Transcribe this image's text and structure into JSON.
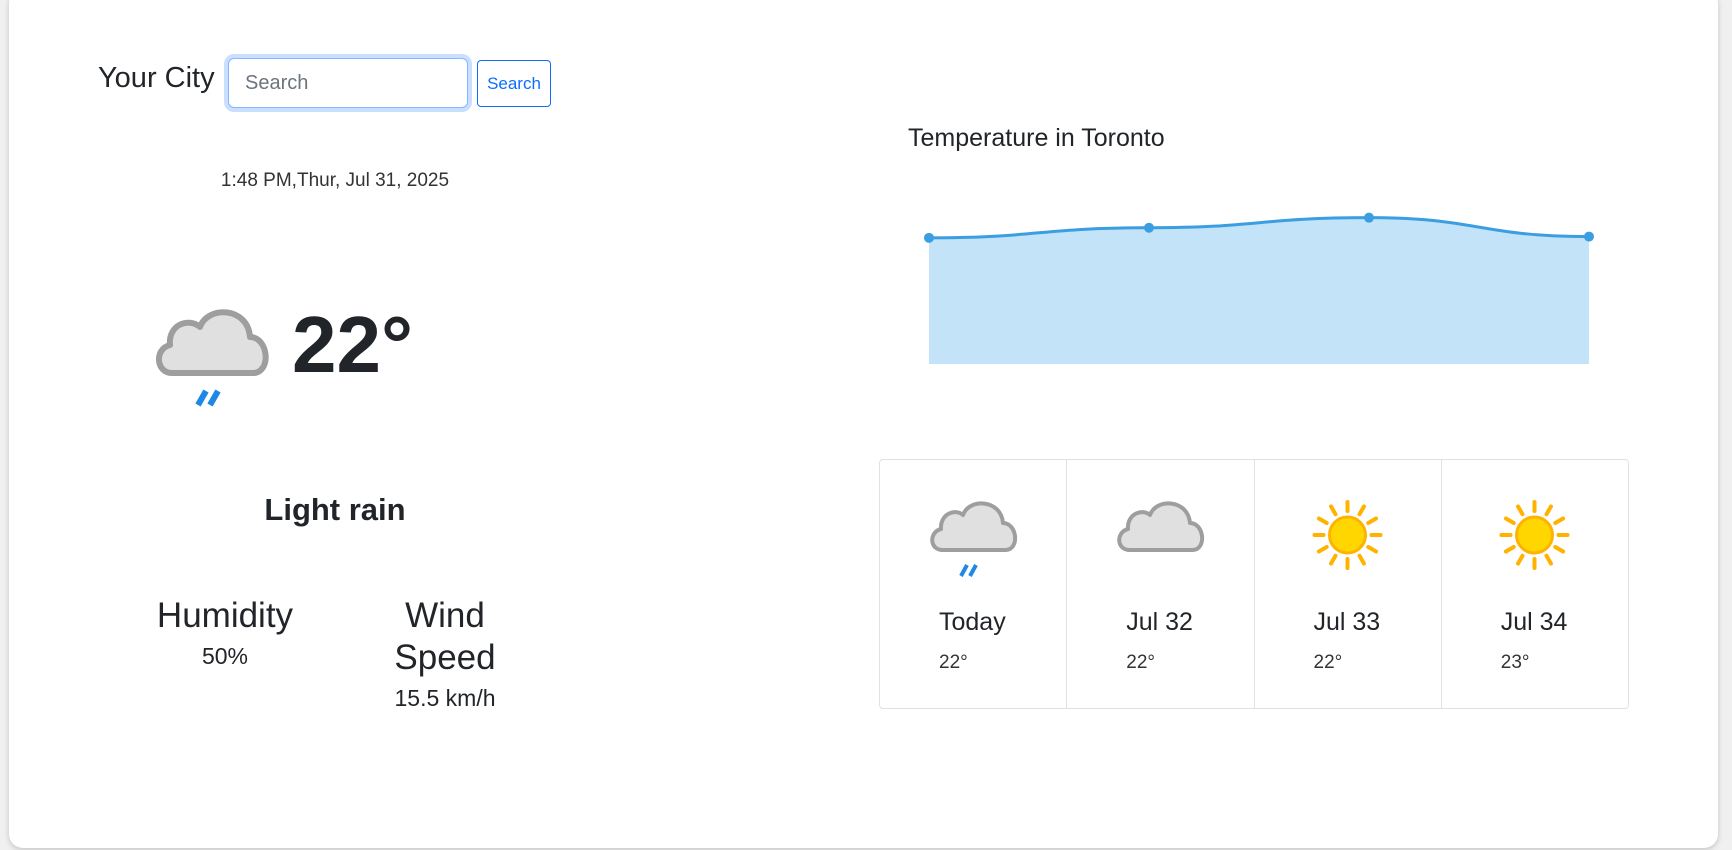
{
  "search": {
    "label": "Your City",
    "placeholder": "Search",
    "button_label": "Search"
  },
  "current": {
    "datetime": "1:48 PM,Thur, Jul 31, 2025",
    "icon": "rain-cloud-icon",
    "temperature": "22°",
    "description": "Light rain",
    "humidity_label": "Humidity",
    "humidity_value": "50%",
    "wind_label": "Wind Speed",
    "wind_value": "15.5 km/h"
  },
  "chart": {
    "title": "Temperature in Toronto",
    "line_color": "#3b9ee0",
    "fill_color": "#c3e3f9"
  },
  "forecast": [
    {
      "day": "Today",
      "temp": "22°",
      "icon": "rain-cloud-icon"
    },
    {
      "day": "Jul 32",
      "temp": "22°",
      "icon": "cloud-icon"
    },
    {
      "day": "Jul 33",
      "temp": "22°",
      "icon": "sun-icon"
    },
    {
      "day": "Jul 34",
      "temp": "23°",
      "icon": "sun-icon"
    }
  ],
  "chart_data": {
    "type": "area",
    "title": "Temperature in Toronto",
    "x": [
      "Today",
      "Jul 32",
      "Jul 33",
      "Jul 34"
    ],
    "values": [
      22.0,
      22.4,
      22.8,
      22.05
    ],
    "ylim": [
      17,
      23.5
    ],
    "grid": false
  },
  "colors": {
    "accent": "#0d6efd",
    "rain": "#1e88e5",
    "sun": "#ffb300",
    "sun_core": "#ffd600",
    "cloud": "#e0e0e0"
  }
}
